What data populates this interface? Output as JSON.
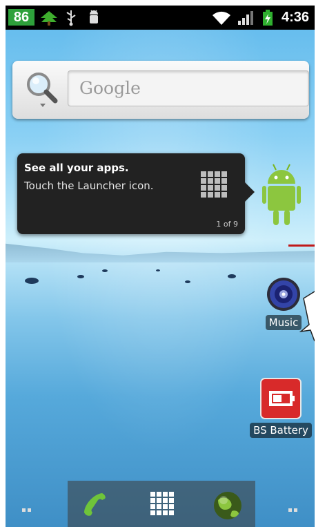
{
  "status_bar": {
    "notification_count": "86",
    "time": "4:36",
    "icons": [
      "tree-icon",
      "usb-icon",
      "android-debug-icon",
      "wifi-icon",
      "signal-icon",
      "battery-charging-icon"
    ]
  },
  "search_widget": {
    "placeholder": "Google"
  },
  "tooltip": {
    "title": "See all your apps.",
    "body": "Touch the Launcher icon.",
    "counter": "1 of 9"
  },
  "apps": {
    "music": "Music",
    "battery": "BS Battery"
  },
  "dock": {
    "items": [
      "phone-icon",
      "launcher-grid-icon",
      "browser-globe-icon"
    ]
  },
  "colors": {
    "badge_green": "#2ea13b",
    "battery_red": "#d82a2a",
    "accent_red_line": "#c0191a"
  }
}
